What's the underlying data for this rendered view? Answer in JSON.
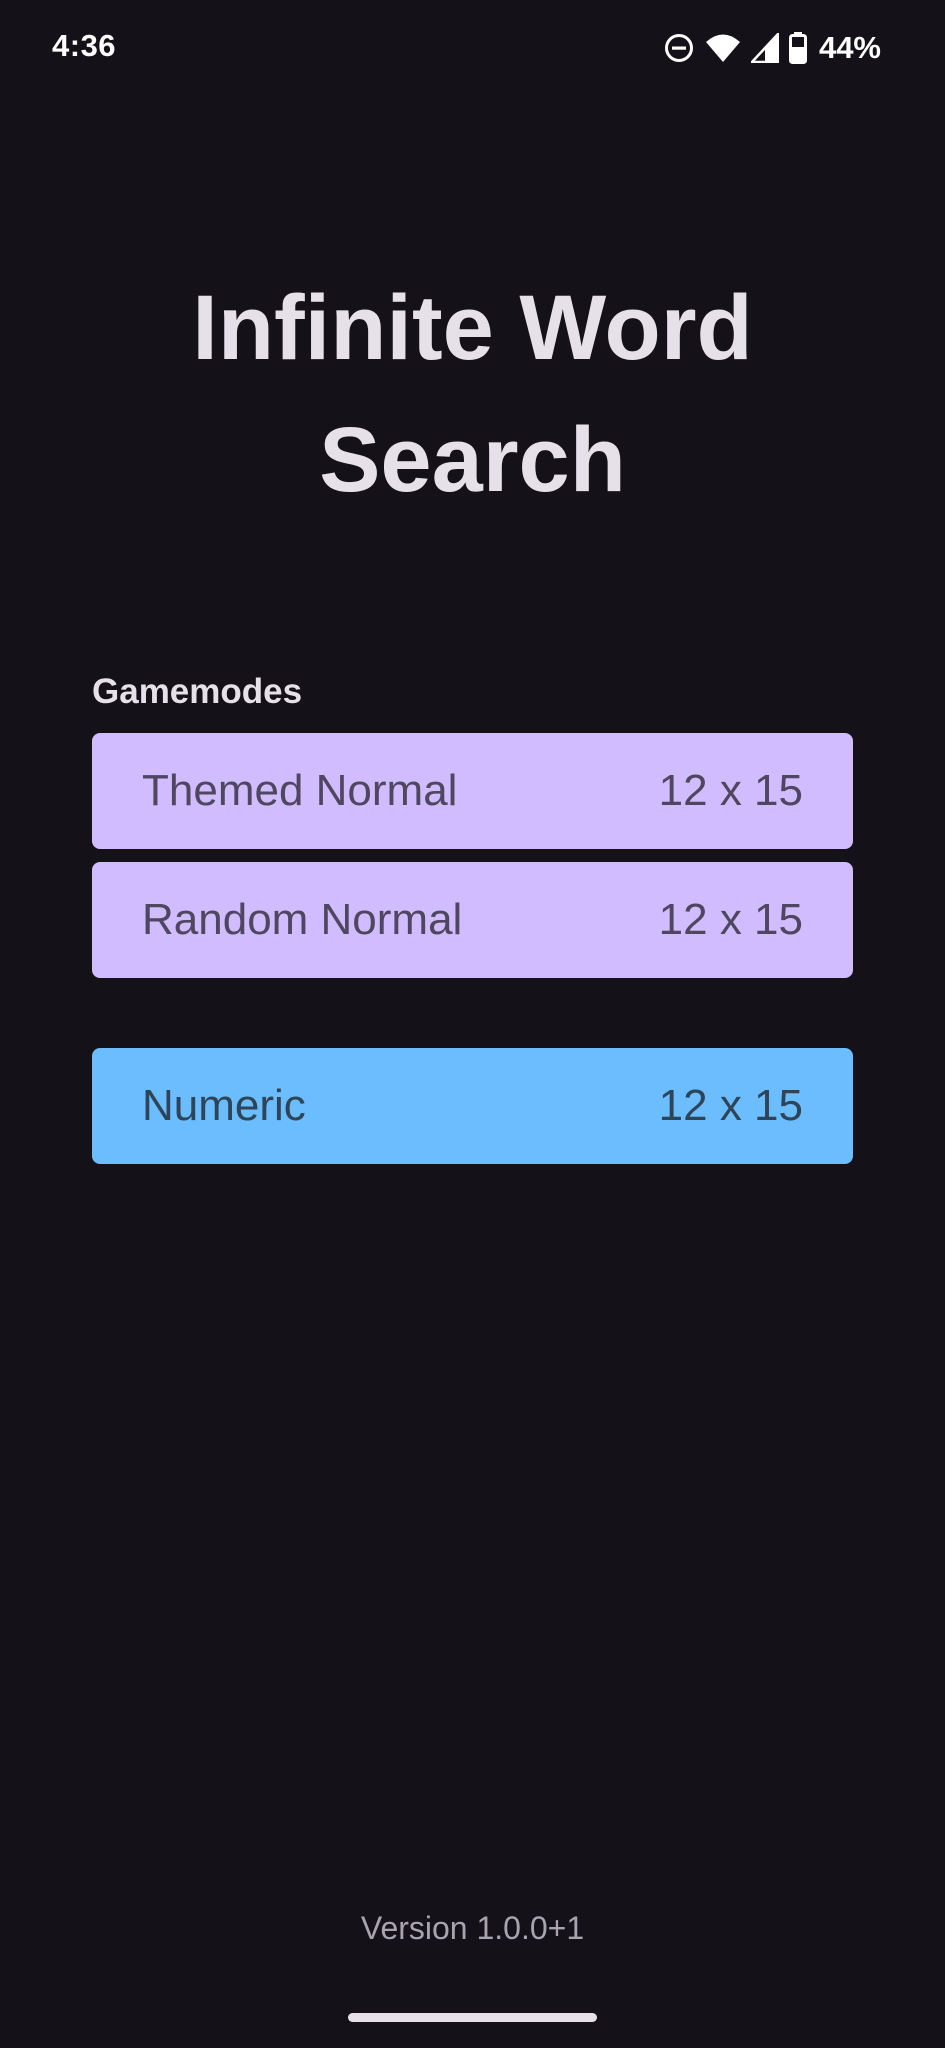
{
  "status_bar": {
    "time": "4:36",
    "battery": "44%",
    "icons": [
      "do-not-disturb-icon",
      "wifi-icon",
      "signal-icon",
      "battery-icon"
    ]
  },
  "app": {
    "title_line1": "Infinite Word",
    "title_line2": "Search"
  },
  "gamemodes": {
    "label": "Gamemodes",
    "modes": [
      {
        "name": "Themed Normal",
        "size": "12 x 15",
        "color": "#D0BCFF"
      },
      {
        "name": "Random Normal",
        "size": "12 x 15",
        "color": "#D0BCFF"
      },
      {
        "name": "Numeric",
        "size": "12 x 15",
        "color": "#6BBDFD"
      }
    ]
  },
  "footer": {
    "version": "Version 1.0.0+1"
  },
  "colors": {
    "background": "#141218",
    "text": "#E6E0E9",
    "purple_button": "#D0BCFF",
    "blue_button": "#6BBDFD"
  }
}
